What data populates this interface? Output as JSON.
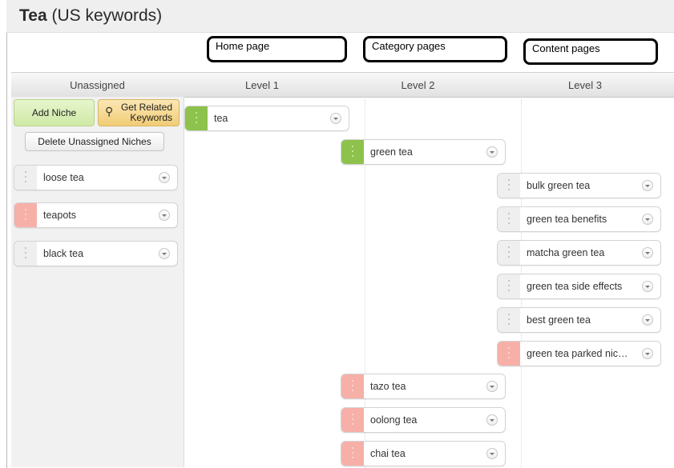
{
  "header": {
    "title_bold": "Tea",
    "title_rest": " (US keywords)"
  },
  "annotations": {
    "home": "Home page",
    "category": "Category pages",
    "content": "Content pages"
  },
  "columns": {
    "unassigned": "Unassigned",
    "level1": "Level 1",
    "level2": "Level 2",
    "level3": "Level 3"
  },
  "actions": {
    "add_niche": "Add Niche",
    "get_related": "Get Related Keywords",
    "delete_unassigned": "Delete Unassigned Niches"
  },
  "colors": {
    "green": "#8dc24c",
    "pink": "#f6b0a8",
    "gray": "#efefef"
  },
  "unassigned": [
    {
      "label": "loose tea",
      "status": "gray"
    },
    {
      "label": "teapots",
      "status": "pink"
    },
    {
      "label": "black tea",
      "status": "gray"
    }
  ],
  "level1": [
    {
      "label": "tea",
      "status": "green"
    }
  ],
  "level2": [
    {
      "label": "green tea",
      "status": "green"
    },
    {
      "label": "tazo tea",
      "status": "pink"
    },
    {
      "label": "oolong tea",
      "status": "pink"
    },
    {
      "label": "chai tea",
      "status": "pink"
    }
  ],
  "level3": [
    {
      "label": "bulk green tea",
      "status": "gray"
    },
    {
      "label": "green tea benefits",
      "status": "gray"
    },
    {
      "label": "matcha green tea",
      "status": "gray"
    },
    {
      "label": "green tea side effects",
      "status": "gray"
    },
    {
      "label": "best green tea",
      "status": "gray"
    },
    {
      "label": "green tea parked nic…",
      "status": "pink"
    }
  ]
}
